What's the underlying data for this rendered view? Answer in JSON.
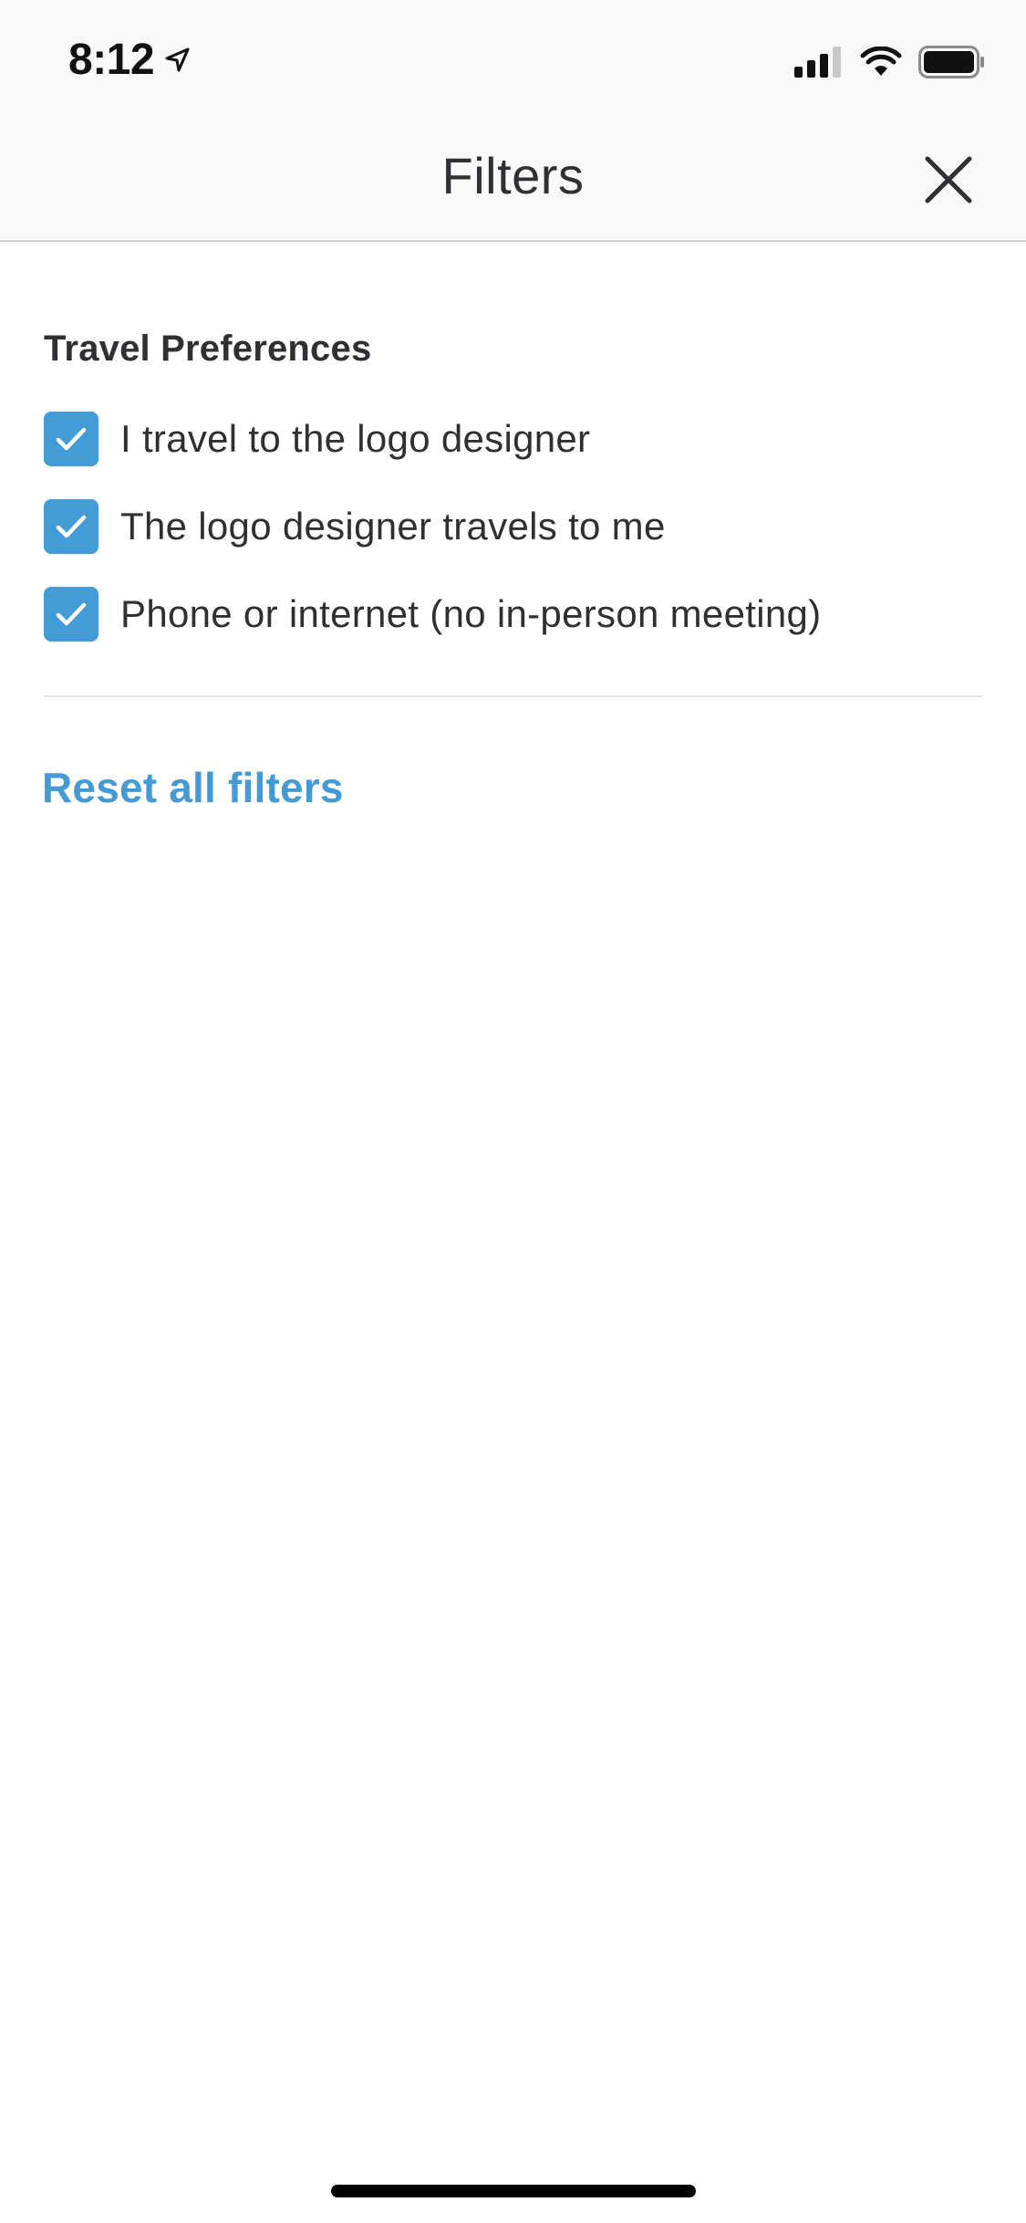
{
  "status_bar": {
    "time": "8:12",
    "icons": [
      "location-arrow-icon",
      "cellular-signal-icon",
      "wifi-icon",
      "battery-icon"
    ]
  },
  "nav": {
    "title": "Filters",
    "close_icon": "close-icon"
  },
  "section": {
    "title": "Travel Preferences",
    "options": [
      {
        "label": "I travel to the logo designer",
        "checked": true
      },
      {
        "label": "The logo designer travels to me",
        "checked": true
      },
      {
        "label": "Phone or internet (no in-person meeting)",
        "checked": true
      }
    ]
  },
  "actions": {
    "reset_label": "Reset all filters"
  },
  "colors": {
    "accent": "#449cd6",
    "link": "#459ad3",
    "text": "#2f3033",
    "header_bg": "#f8f8f8"
  }
}
